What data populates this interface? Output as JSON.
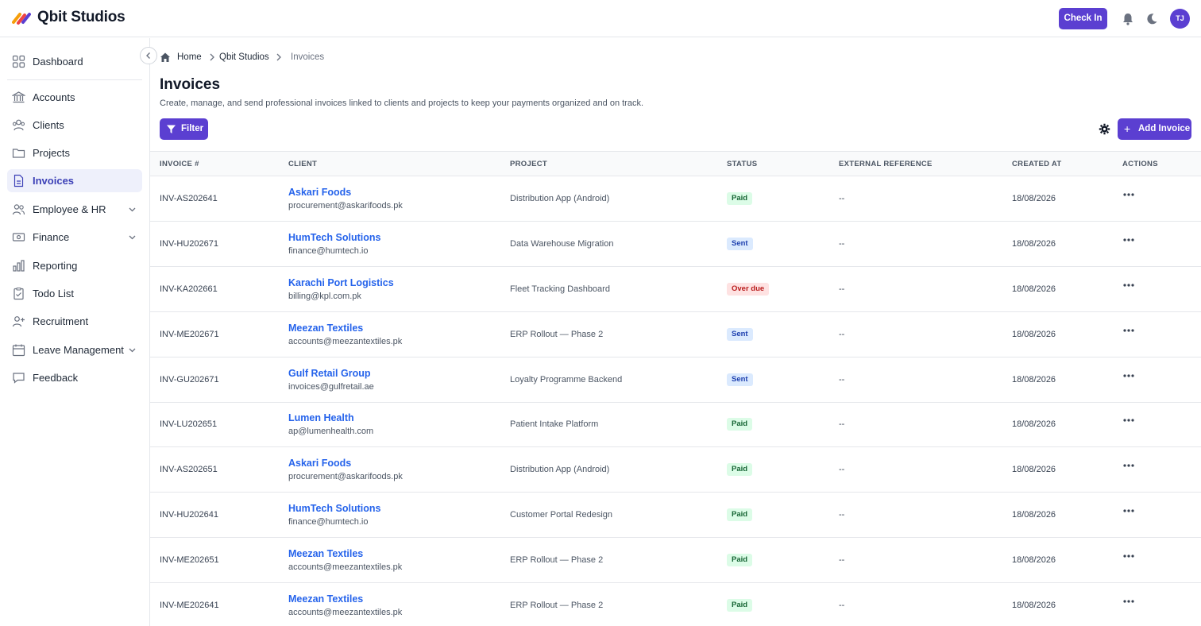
{
  "app": {
    "name": "Qbit Studios"
  },
  "header": {
    "check_in_label": "Check In",
    "avatar_initials": "TJ"
  },
  "colors": {
    "accent": "#5b3fd1",
    "link": "#2563eb",
    "paid": "#166534",
    "sent": "#1e40af",
    "overdue": "#b91c1c"
  },
  "sidebar": {
    "items": [
      {
        "label": "Dashboard",
        "icon": "grid-icon"
      },
      {
        "label": "Accounts",
        "icon": "bank-icon"
      },
      {
        "label": "Clients",
        "icon": "users-icon"
      },
      {
        "label": "Projects",
        "icon": "folder-icon"
      },
      {
        "label": "Invoices",
        "icon": "document-icon",
        "active": true
      },
      {
        "label": "Employee & HR",
        "icon": "people-icon",
        "expandable": true
      },
      {
        "label": "Finance",
        "icon": "cash-icon",
        "expandable": true
      },
      {
        "label": "Reporting",
        "icon": "bar-chart-icon"
      },
      {
        "label": "Todo List",
        "icon": "clipboard-check-icon"
      },
      {
        "label": "Recruitment",
        "icon": "user-plus-icon"
      },
      {
        "label": "Leave Management",
        "icon": "calendar-icon",
        "expandable": true
      },
      {
        "label": "Feedback",
        "icon": "chat-icon"
      }
    ]
  },
  "breadcrumb": {
    "home": "Home",
    "org": "Qbit Studios",
    "current": "Invoices"
  },
  "page": {
    "title": "Invoices",
    "description": "Create, manage, and send professional invoices linked to clients and projects to keep your payments organized and on track.",
    "filter_label": "Filter",
    "add_label": "Add Invoice"
  },
  "table": {
    "columns": [
      "INVOICE #",
      "CLIENT",
      "PROJECT",
      "STATUS",
      "EXTERNAL REFERENCE",
      "CREATED AT",
      "ACTIONS"
    ],
    "rows": [
      {
        "invoice": "INV-AS202641",
        "client": "Askari Foods",
        "email": "procurement@askarifoods.pk",
        "project": "Distribution App (Android)",
        "status": "Paid",
        "ext_ref": "--",
        "created": "18/08/2026"
      },
      {
        "invoice": "INV-HU202671",
        "client": "HumTech Solutions",
        "email": "finance@humtech.io",
        "project": "Data Warehouse Migration",
        "status": "Sent",
        "ext_ref": "--",
        "created": "18/08/2026"
      },
      {
        "invoice": "INV-KA202661",
        "client": "Karachi Port Logistics",
        "email": "billing@kpl.com.pk",
        "project": "Fleet Tracking Dashboard",
        "status": "Over due",
        "ext_ref": "--",
        "created": "18/08/2026"
      },
      {
        "invoice": "INV-ME202671",
        "client": "Meezan Textiles",
        "email": "accounts@meezantextiles.pk",
        "project": "ERP Rollout — Phase 2",
        "status": "Sent",
        "ext_ref": "--",
        "created": "18/08/2026"
      },
      {
        "invoice": "INV-GU202671",
        "client": "Gulf Retail Group",
        "email": "invoices@gulfretail.ae",
        "project": "Loyalty Programme Backend",
        "status": "Sent",
        "ext_ref": "--",
        "created": "18/08/2026"
      },
      {
        "invoice": "INV-LU202651",
        "client": "Lumen Health",
        "email": "ap@lumenhealth.com",
        "project": "Patient Intake Platform",
        "status": "Paid",
        "ext_ref": "--",
        "created": "18/08/2026"
      },
      {
        "invoice": "INV-AS202651",
        "client": "Askari Foods",
        "email": "procurement@askarifoods.pk",
        "project": "Distribution App (Android)",
        "status": "Paid",
        "ext_ref": "--",
        "created": "18/08/2026"
      },
      {
        "invoice": "INV-HU202641",
        "client": "HumTech Solutions",
        "email": "finance@humtech.io",
        "project": "Customer Portal Redesign",
        "status": "Paid",
        "ext_ref": "--",
        "created": "18/08/2026"
      },
      {
        "invoice": "INV-ME202651",
        "client": "Meezan Textiles",
        "email": "accounts@meezantextiles.pk",
        "project": "ERP Rollout — Phase 2",
        "status": "Paid",
        "ext_ref": "--",
        "created": "18/08/2026"
      },
      {
        "invoice": "INV-ME202641",
        "client": "Meezan Textiles",
        "email": "accounts@meezantextiles.pk",
        "project": "ERP Rollout — Phase 2",
        "status": "Paid",
        "ext_ref": "--",
        "created": "18/08/2026"
      }
    ]
  }
}
